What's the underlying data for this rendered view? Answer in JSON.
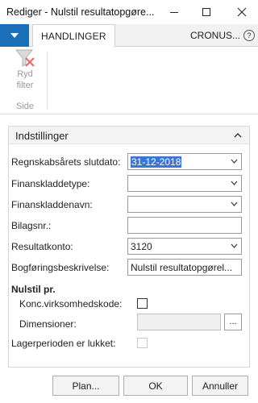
{
  "window": {
    "title": "Rediger - Nulstil resultatopgøre..."
  },
  "ribbon": {
    "tab_label": "HANDLINGER",
    "company": "CRONUS...",
    "help_label": "?",
    "commands": [
      {
        "line1": "Ryd",
        "line2": "filter",
        "icon": "clear-filter-icon"
      }
    ],
    "group_label": "Side"
  },
  "panel": {
    "title": "Indstillinger",
    "fields": {
      "fiscal_year_end": {
        "label": "Regnskabsårets slutdato:",
        "value": "31-12-2018"
      },
      "journal_template": {
        "label": "Finanskladdetype:",
        "value": ""
      },
      "journal_batch": {
        "label": "Finanskladdenavn:",
        "value": ""
      },
      "document_no": {
        "label": "Bilagsnr.:",
        "value": ""
      },
      "retained_earnings": {
        "label": "Resultatkonto:",
        "value": "3120"
      },
      "posting_description": {
        "label": "Bogføringsbeskrivelse:",
        "value": "Nulstil resultatopgørel..."
      }
    },
    "close_by_section": "Nulstil pr.",
    "business_unit": {
      "label": "Konc.virksomhedskode:",
      "checked": false
    },
    "dimensions": {
      "label": "Dimensioner:",
      "value": "",
      "assist_label": "..."
    },
    "inventory_closed": {
      "label": "Lagerperioden er lukket:",
      "checked": false
    }
  },
  "buttons": {
    "plan": "Plan...",
    "ok": "OK",
    "cancel": "Annuller"
  },
  "colors": {
    "accent": "#1a6fb8",
    "selection": "#3b74d4",
    "clear_filter_red": "#e06a6a"
  }
}
